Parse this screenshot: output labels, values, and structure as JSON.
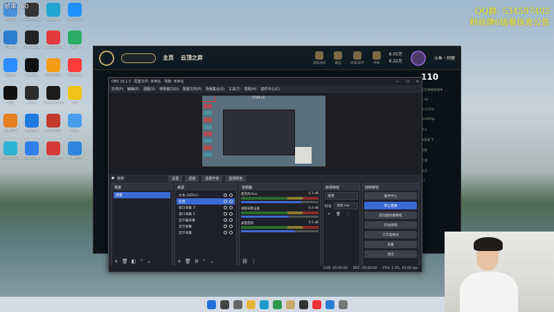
{
  "overlay": {
    "fps_text": "帧率: 60",
    "qq_line": "QQ群: 534597402",
    "promo_line": "粉丝牌6级看信息公告"
  },
  "desktop_icons": [
    {
      "label": "此电脑",
      "color": "#4a90d9"
    },
    {
      "label": "YouTube App",
      "color": "#333"
    },
    {
      "label": "Wallpaper",
      "color": "#22a6d1"
    },
    {
      "label": "Bilibili App",
      "color": "#1e90ff"
    },
    {
      "label": "回收站",
      "color": "#2a7fd0"
    },
    {
      "label": "OBS Studio",
      "color": "#222"
    },
    {
      "label": "Everything",
      "color": "#e23b3b"
    },
    {
      "label": "微信",
      "color": "#2aae67"
    },
    {
      "label": "Zoom",
      "color": "#2d8cff"
    },
    {
      "label": "ZeroTier",
      "color": "#111"
    },
    {
      "label": "QQ浏览器",
      "color": "#f39c12"
    },
    {
      "label": "WeGame",
      "color": "#ff3b3b"
    },
    {
      "label": "抖音",
      "color": "#111"
    },
    {
      "label": "Clash",
      "color": "#2b2b2b"
    },
    {
      "label": "Clash for Windows",
      "color": "#1c1c1c"
    },
    {
      "label": "QQ",
      "color": "#f0c419"
    },
    {
      "label": "火绒安全",
      "color": "#e67e22"
    },
    {
      "label": "腾讯视频",
      "color": "#1f7ae0"
    },
    {
      "label": "网易云音乐",
      "color": "#c0392b"
    },
    {
      "label": "Kook",
      "color": "#4a9ced"
    },
    {
      "label": "Microsoft Edge",
      "color": "#2db3d6"
    },
    {
      "label": "Stream Deck",
      "color": "#2f80ed"
    },
    {
      "label": "WPS Office",
      "color": "#d63a3a"
    },
    {
      "label": "直播伴侣",
      "color": "#2e86de"
    }
  ],
  "lol": {
    "nav_home": "主页",
    "nav_cloud": "云顶之弈",
    "top_icons": [
      {
        "label": "暗影战场"
      },
      {
        "label": "藏品"
      },
      {
        "label": "商城/菜单"
      },
      {
        "label": "商城"
      }
    ],
    "currency_blue": "6.01万",
    "currency_orange": "6.22万",
    "player_name": "斗鱼丶阿狸",
    "player_level": "136",
    "side_level": "110",
    "side_lines": [
      "正在寻找对局中",
      "1:40",
      "(1/1331)",
      "(1GMTgo",
      "敏入",
      "敢取安飞",
      "玩家",
      "订阅",
      "双方",
      "17"
    ],
    "side_more": "更多"
  },
  "obs": {
    "title": "OBS 29.1.3 - 配置文件: 未命名 - 场景: 未命名",
    "menu": [
      "文件(F)",
      "编辑(E)",
      "视图(V)",
      "停靠窗口(D)",
      "配置文件(P)",
      "场景集合(S)",
      "工具(T)",
      "帮助(H)",
      "插件中心(C)"
    ],
    "preview_size": "1748 x1",
    "scene_label": "我想",
    "scene_buttons": [
      "设置",
      "滤镜",
      "选择字体",
      "选择颜色"
    ],
    "docks": {
      "scenes": {
        "title": "场景",
        "items": [
          "场景"
        ]
      },
      "sources": {
        "title": "来源",
        "items": [
          {
            "name": "文本 (GDI+)",
            "selected": false
          },
          {
            "name": "抖音",
            "selected": true
          },
          {
            "name": "窗口采集 3",
            "selected": false
          },
          {
            "name": "窗口采集 2",
            "selected": false
          },
          {
            "name": "显示器采集",
            "selected": false
          },
          {
            "name": "显示采集",
            "selected": false
          },
          {
            "name": "显示采集",
            "selected": false
          }
        ]
      },
      "mixer": {
        "title": "音频器",
        "channels": [
          {
            "name": "麦克风/Aux",
            "db": "6.3 dB",
            "level": 0.78
          },
          {
            "name": "视频采集设备",
            "db": "0.0 dB",
            "level": 0.62
          },
          {
            "name": "桌面音频",
            "db": "0.0 dB",
            "level": 0.7
          }
        ]
      },
      "transitions": {
        "title": "转场特效",
        "type": "渐变",
        "duration_label": "时长",
        "duration_value": "300 ms"
      },
      "controls": {
        "title": "控制按钮",
        "buttons": [
          {
            "label": "插件中心",
            "active": false
          },
          {
            "label": "停止直播",
            "active": true
          },
          {
            "label": "启动虚拟摄像机",
            "active": false
          },
          {
            "label": "开始录制",
            "active": false
          },
          {
            "label": "工作室模式",
            "active": false
          },
          {
            "label": "设置",
            "active": false
          },
          {
            "label": "退出",
            "active": false
          }
        ]
      }
    },
    "status": {
      "live": "LIVE: 00:00:00",
      "rec": "REC: 00:00:00",
      "cpu": "CPU: 2.3%, 60.00 fps"
    }
  },
  "taskbar": {
    "icons": [
      "windows",
      "search",
      "task-view",
      "file-explorer",
      "edge",
      "chrome",
      "league",
      "obs",
      "wegame",
      "qq",
      "settings"
    ]
  }
}
